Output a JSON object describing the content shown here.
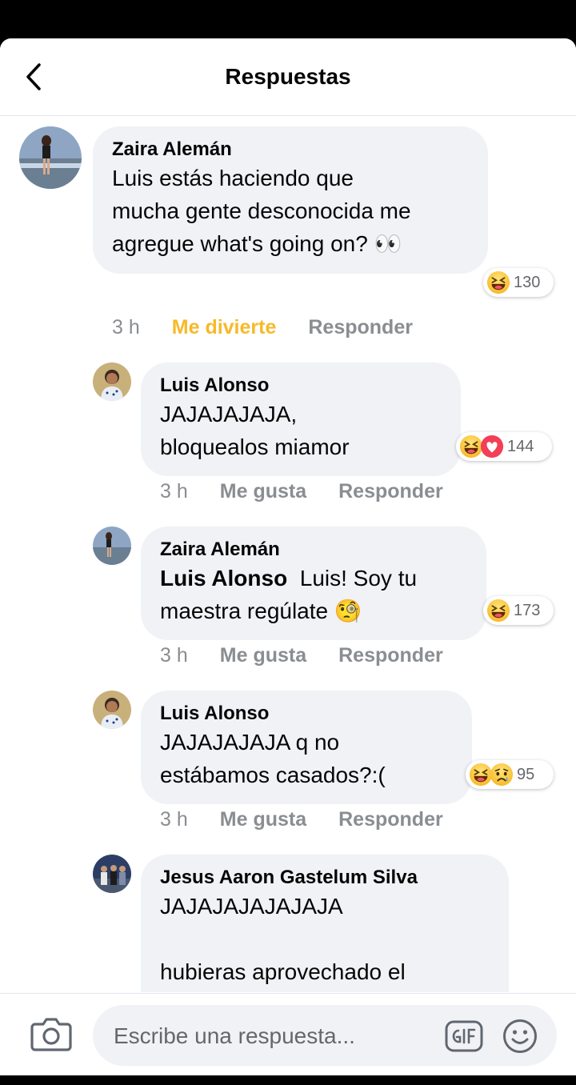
{
  "header": {
    "title": "Respuestas",
    "back_icon": "chevron-left-icon"
  },
  "comments": [
    {
      "author": "Zaira Alemán",
      "text": "Luis estás haciendo que\nmucha gente desconocida me\nagregue what's going on? 👀",
      "reactions": [
        "haha"
      ],
      "reaction_count": "130",
      "time": "3 h",
      "like_label": "Me divierte",
      "like_active": true,
      "reply_label": "Responder"
    },
    {
      "author": "Luis Alonso",
      "text": "JAJAJAJAJA,\nbloquealos miamor",
      "reactions": [
        "haha",
        "love"
      ],
      "reaction_count": "144",
      "time": "3 h",
      "like_label": "Me gusta",
      "like_active": false,
      "reply_label": "Responder"
    },
    {
      "author": "Zaira Alemán",
      "mention": "Luis Alonso",
      "text": "  Luis! Soy tu\nmaestra regúlate 🧐",
      "reactions": [
        "haha"
      ],
      "reaction_count": "173",
      "time": "3 h",
      "like_label": "Me gusta",
      "like_active": false,
      "reply_label": "Responder"
    },
    {
      "author": "Luis Alonso",
      "text": "JAJAJAJAJA q no\nestábamos casados?:(",
      "reactions": [
        "haha",
        "sad"
      ],
      "reaction_count": "95",
      "time": "3 h",
      "like_label": "Me gusta",
      "like_active": false,
      "reply_label": "Responder"
    },
    {
      "author": "Jesus Aaron Gastelum Silva",
      "text": "JAJAJAJAJAJAJA\n\nhubieras aprovechado el\nmariachi cuando tocamos"
    }
  ],
  "composer": {
    "placeholder": "Escribe una respuesta...",
    "camera_icon": "camera-icon",
    "gif_icon": "gif-icon",
    "emoji_icon": "smiley-icon"
  },
  "colors": {
    "active_reaction": "#f7b928",
    "bubble": "#f0f2f5",
    "meta": "#8a8d91"
  }
}
